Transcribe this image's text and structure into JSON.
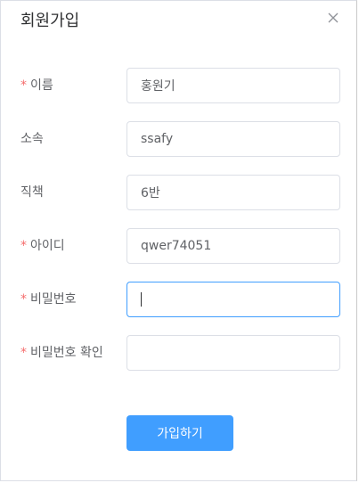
{
  "dialog": {
    "title": "회원가입",
    "close_icon": "close-icon"
  },
  "form": {
    "required_marker": "*",
    "fields": [
      {
        "label": "이름",
        "required": true,
        "value": "홍원기"
      },
      {
        "label": "소속",
        "required": false,
        "value": "ssafy"
      },
      {
        "label": "직책",
        "required": false,
        "value": "6반"
      },
      {
        "label": "아이디",
        "required": true,
        "value": "qwer74051"
      },
      {
        "label": "비밀번호",
        "required": true,
        "value": "",
        "focused": true
      },
      {
        "label": "비밀번호 확인",
        "required": true,
        "value": ""
      }
    ],
    "submit_label": "가입하기"
  },
  "colors": {
    "primary": "#409eff",
    "required": "#f56c6c",
    "border": "#dcdfe6",
    "text": "#606266"
  }
}
